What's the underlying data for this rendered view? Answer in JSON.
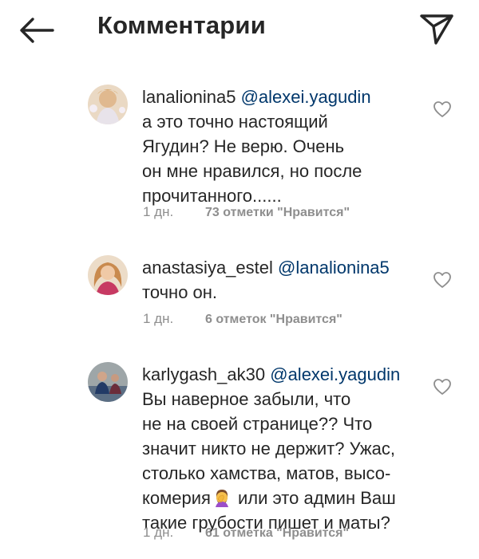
{
  "header": {
    "title": "Комментарии"
  },
  "comments": [
    {
      "username": "lanalionina5",
      "mention": "@alexei.yagudin",
      "lines": [
        "а это точно настоящий",
        "Ягудин? Не верю. Очень",
        "он мне нравился, но после",
        "прочитанного......"
      ],
      "time": "1 дн.",
      "likes": "73 отметки \"Нравится\""
    },
    {
      "username": "anastasiya_estel",
      "mention": "@lanalionina5",
      "lines": [
        "точно он."
      ],
      "time": "1 дн.",
      "likes": "6 отметок \"Нравится\""
    },
    {
      "username": "karlygash_ak30",
      "mention": "@alexei.yagudin",
      "lines": [
        "Вы наверное забыли, что",
        "не на своей странице?? Что",
        "значит никто не держит? Ужас,",
        "столько хамства, матов, высо-"
      ],
      "line5_before": "комерия",
      "line5_after": " или это админ Ваш",
      "line6": "такие грубости пишет и маты?",
      "time": "1 дн.",
      "likes": "61 отметка \"Нравится\""
    }
  ],
  "icons": {
    "back": "arrow-left-icon",
    "share": "paper-plane-icon",
    "like": "heart-outline-icon",
    "emoji": "facepalm-woman-emoji"
  },
  "colors": {
    "text": "#262626",
    "mention": "#00376b",
    "meta": "#8e8e8e"
  }
}
